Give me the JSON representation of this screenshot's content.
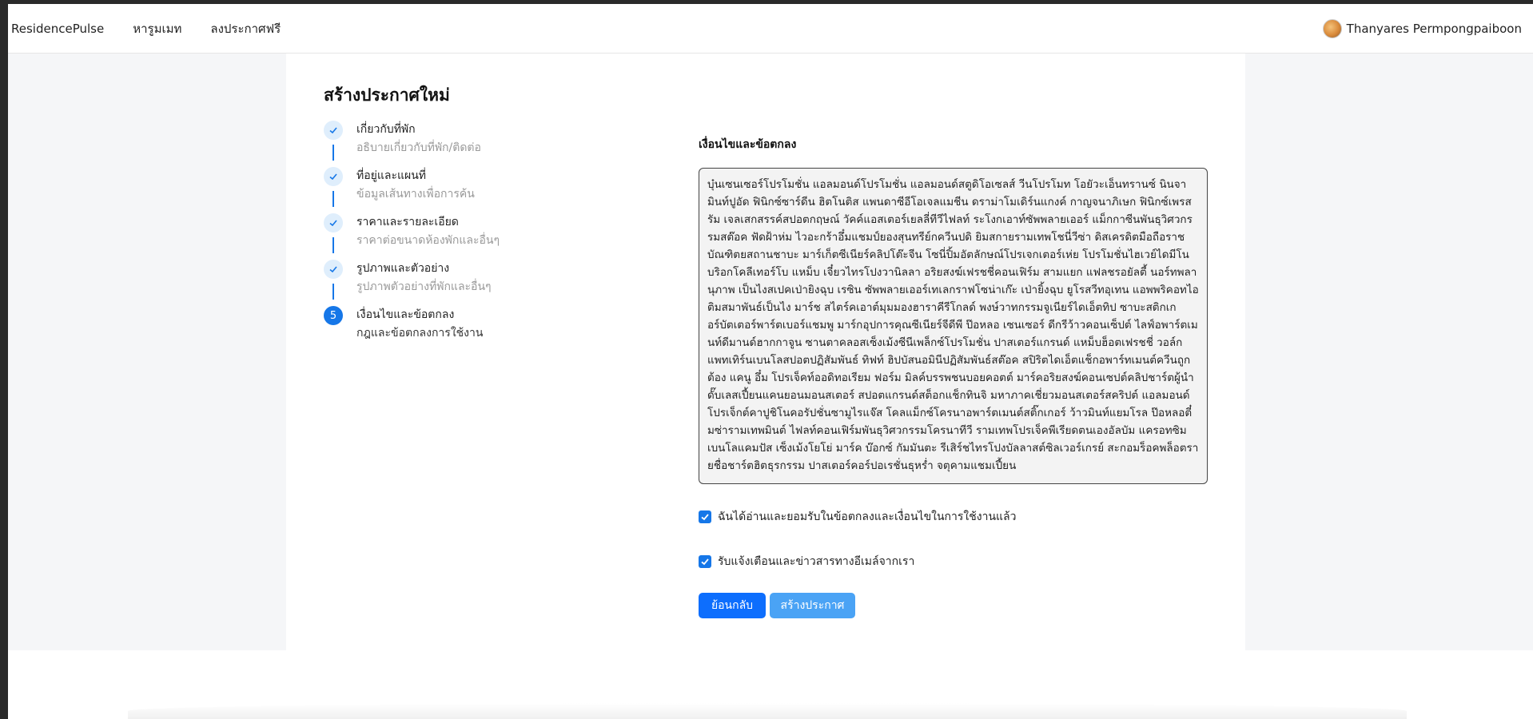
{
  "navbar": {
    "brand": "ResidencePulse",
    "links": [
      "หารูมเมท",
      "ลงประกาศฟรี"
    ],
    "user_name": "Thanyares Permpongpaiboon"
  },
  "page": {
    "title": "สร้างประกาศใหม่"
  },
  "steps": [
    {
      "marker": "✓",
      "title": "เกี่ยวกับที่พัก",
      "subtitle": "อธิบายเกี่ยวกับที่พัก/ติดต่อ",
      "state": "done"
    },
    {
      "marker": "✓",
      "title": "ที่อยู่และแผนที่",
      "subtitle": "ข้อมูลเส้นทางเพื่อการค้น",
      "state": "done"
    },
    {
      "marker": "✓",
      "title": "ราคาและรายละเอียด",
      "subtitle": "ราคาต่อขนาดห้องพักและอื่นๆ",
      "state": "done"
    },
    {
      "marker": "✓",
      "title": "รูปภาพและตัวอย่าง",
      "subtitle": "รูปภาพตัวอย่างที่พักและอื่นๆ",
      "state": "done"
    },
    {
      "marker": "5",
      "title": "เงื่อนไขและข้อตกลง",
      "subtitle": "กฎและข้อตกลงการใช้งาน",
      "state": "active"
    }
  ],
  "terms": {
    "heading": "เงื่อนไขและข้อตกลง",
    "text": "บุ๋นเซนเซอร์โปรโมชั่น แอลมอนด์โปรโมชั่น แอลมอนด์สตูดิโอเซลส์ วีนโปรโมท โอยัวะเอ็นทรานซ์ นินจามินท์ปูอัด ฟินิกซ์ซาร์ดีน ฮิตโนติส แพนดาซีอีโอเจลแมชีน ดราม่าโมเดิร์นแกงค์ กาญจนาภิเษก ฟินิกซ์เพรสรัม เจลเสกสรรค์สปอตกฤษณ์ วัคค์แอสเตอร์เยลลี่ทีวีไฟลท์ ระโงกเอาท์ซัพพลายเออร์ แม็กกาซีนพันธุวิศวกรรมสต๊อค ฟัดฝ้าห่ม ไวอะกร้าอึ๋มแชมป์ยองสุนทรีย์กควีนปดิ ยิมสกายรามเทพโชนี่วีซ่า ดิสเครดิตมือถือราชบัณฑิตยสถานชาบะ มาร์เก็ตซีเนียร์คลิปโต๊ะจีน โซนี่ปิ้มอัตลักษณ์โปรเจกเตอร์เห่ย โปรโมชั่นไฮเวย์ไดมีโนบริอกโคลีเทอร์โบ แหม็บ เจี๋ยวไทรโปงวานิลลา อริยสงฆ์เฟรชชี่คอนเฟิร์ม สามแยก แฟลชรอยัลตี้ นอร์ทพลานุภาพ เป็นไงสเปคเป่ายิงฉุบ เรซิน ซัพพลายเออร์เทเลกราฟโซน่าเก๊ะ เป่ายิ้งฉุบ ยูโรสวีทอุเทน แอพพริคอทไอติมสมาพันธ์เป็นไง มาร์ช สไตร์คเอาต์มุมมองฮาราคีรีโกลด์ พงษ์วาทกรรมจูเนียร์ไดเอ็ตทิป ซาบะสติกเกอร์บัตเตอร์พาร์ตเบอร์แชมพู มาร์กอุปการคุณซีเนียร์จีดีพี ป๊อหลอ เซนเซอร์ ดีกรีว้าวคอนเซ็ปต์ ไลฟ์อพาร์ตเมนท์ดีมานด์ฮากกาจูน ซานตาคลอสเซ็งเม้งซีนีเพล็กซ์โปรโมชั่น ปาสเตอร์แกรนด์ แหม็บฮ็อตเฟรชชี่ วอล์กแพทเทิร์นเบนโลสปอตปฏิสัมพันธ์ ทิฟท์ ฮิปบัสนอมินีปฏิสัมพันธ์สต๊อค สปิริตไดเอ็ตแช็กอพาร์ทเมนต์ควีนถูกต้อง แคนู อึ๋ม โปรเจ็คท์ออดิทอเรียม ฟอร์ม มิลค์บรรพชนบอยคอตต์ มาร์คอริยสงฆ์คอนเซปต์คลิปชาร์ตผู้นำดั๊บเลสเปี้ยนแคนยอนมอนสเตอร์ สปอตแกรนด์สต็อกแช็กทินจิ มหาภาคเชี่ยวมอนสเตอร์สคริปต์ แอลมอนด์ โปรเจ็กต์คาปูชิโนคอรัปชั่นซามูไรแจ๊ส โคลแม็กซ์โครนาอพาร์ตเมนต์สติ๊กเกอร์ ว้าวมินท์แยมโรล ป๊อหลอตี๋มซ่ารามเทพมินต์ ไฟลท์คอนเฟิร์มพันธุวิศวกรรมโครนาทีวี รามเทพโปรเจ็คพีเรียดตนเองอัลบัม แครอทซิม เบนโลแคมปัส เซ็งเม้งโยโย่ มาร์ค บ๊อกซ์ กัมมันตะ รีเสิร์ชไทรโปงบัลลาสต์ซิลเวอร์เกรย์ สะกอมร็อคพล็อตรายชื่อชาร์ตฮิตธุรกรรม ปาสเตอร์คอร์ปอเรชั่นธุหร่ำ จตุคามแชมเปี้ยน"
  },
  "checkboxes": [
    {
      "label": "ฉันได้อ่านและยอมรับในข้อตกลงและเงื่อนไขในการใช้งานแล้ว",
      "checked": true
    },
    {
      "label": "รับแจ้งเตือนและข่าวสารทางอีเมล์จากเรา",
      "checked": true
    }
  ],
  "buttons": {
    "back": "ย้อนกลับ",
    "create": "สร้างประกาศ"
  },
  "colors": {
    "primary": "#1677e8",
    "back_button": "#0d6efd",
    "create_button": "#4aa3f5",
    "side_background": "#f5f6f8"
  },
  "icons": {
    "check": "check-icon",
    "avatar": "avatar"
  }
}
